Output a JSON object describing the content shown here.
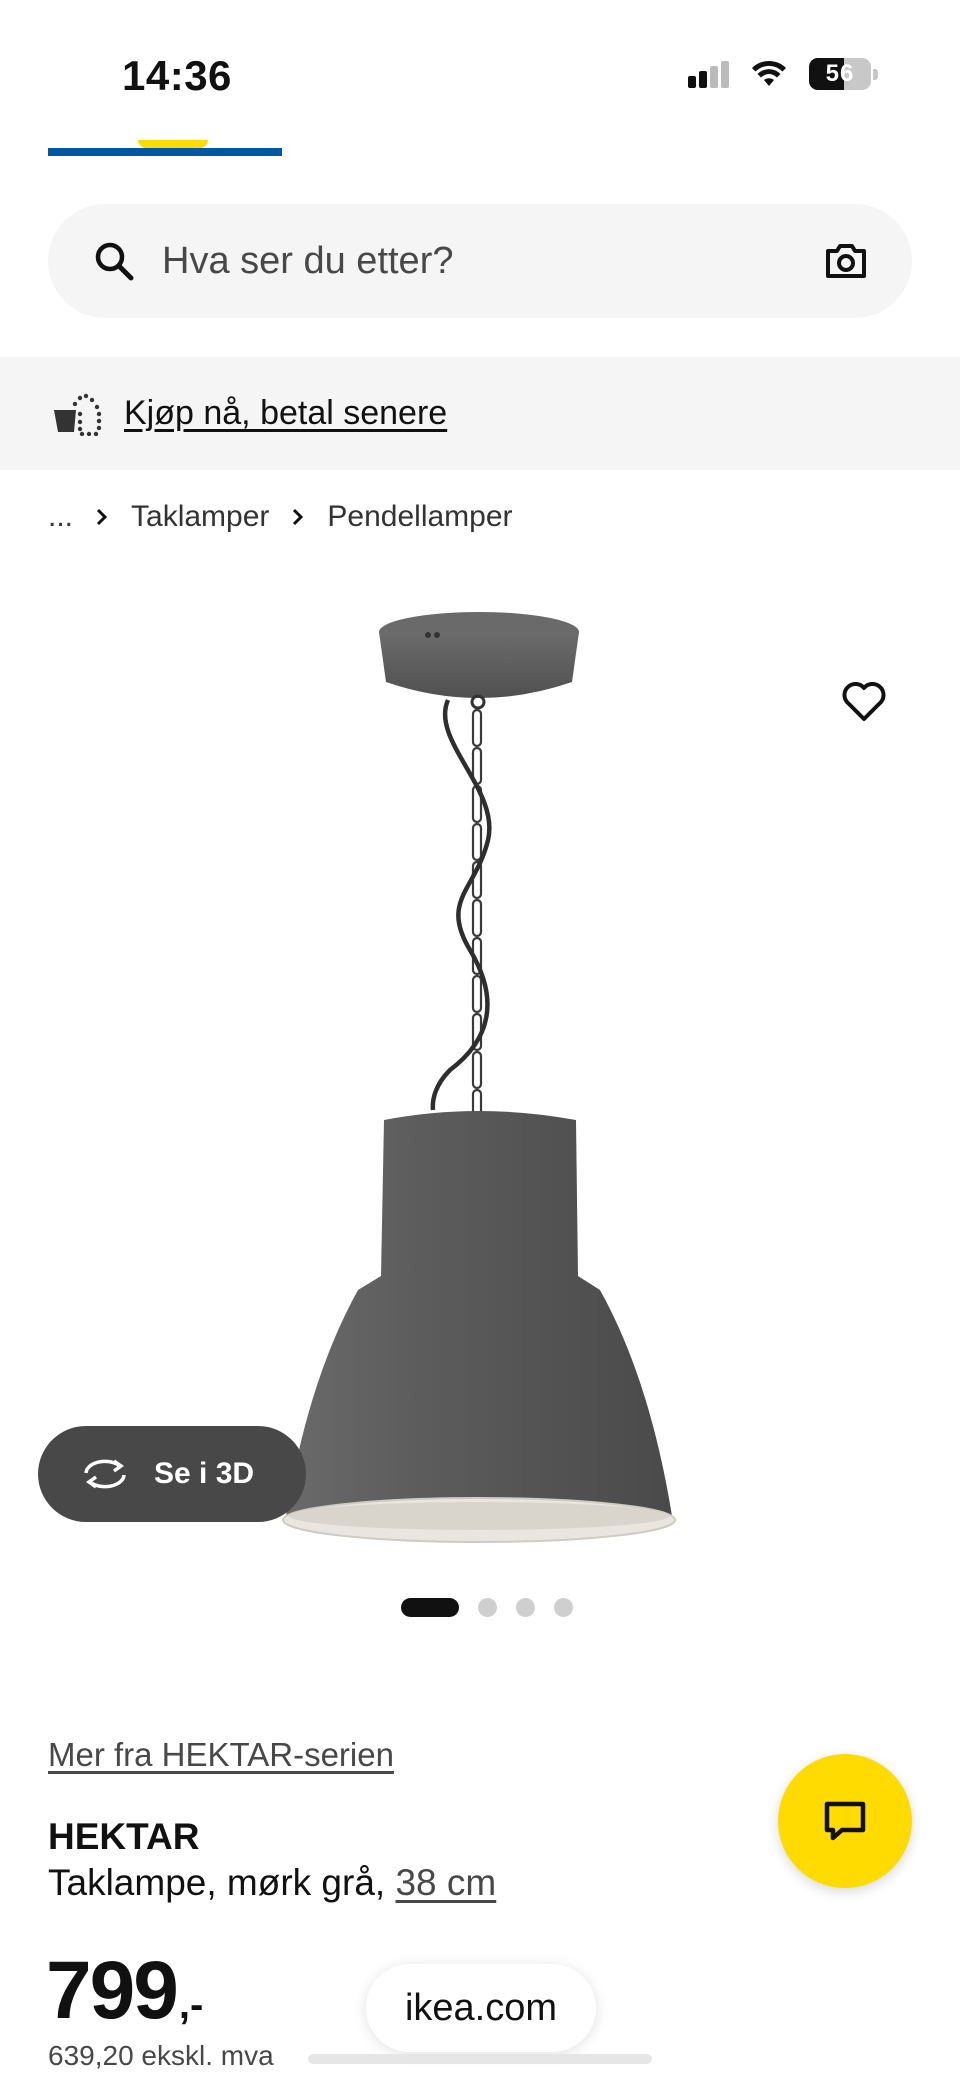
{
  "status_bar": {
    "time": "14:36",
    "battery": "56",
    "icons": [
      "signal-icon",
      "wifi-icon",
      "battery-icon"
    ]
  },
  "search": {
    "placeholder": "Hva ser du etter?",
    "icons": [
      "search-icon",
      "camera-icon"
    ]
  },
  "promo": {
    "label": "Kjøp nå, betal senere",
    "icon": "basket-icon"
  },
  "breadcrumb": {
    "items": [
      "...",
      "Taklamper",
      "Pendellamper"
    ]
  },
  "product": {
    "image_count": 4,
    "active_image": 1,
    "view_3d_label": "Se i 3D",
    "series_link": "Mer fra HEKTAR-serien",
    "name": "HEKTAR",
    "description": "Taklampe, mørk grå,",
    "size": "38 cm",
    "price": "799",
    "price_suffix": ",-",
    "price_ex_vat": "639,20 ekskl. mva"
  },
  "browser": {
    "url": "ikea.com"
  },
  "colors": {
    "brand_blue": "#0058a3",
    "brand_yellow": "#ffdb00",
    "lamp_grey": "#585858"
  }
}
